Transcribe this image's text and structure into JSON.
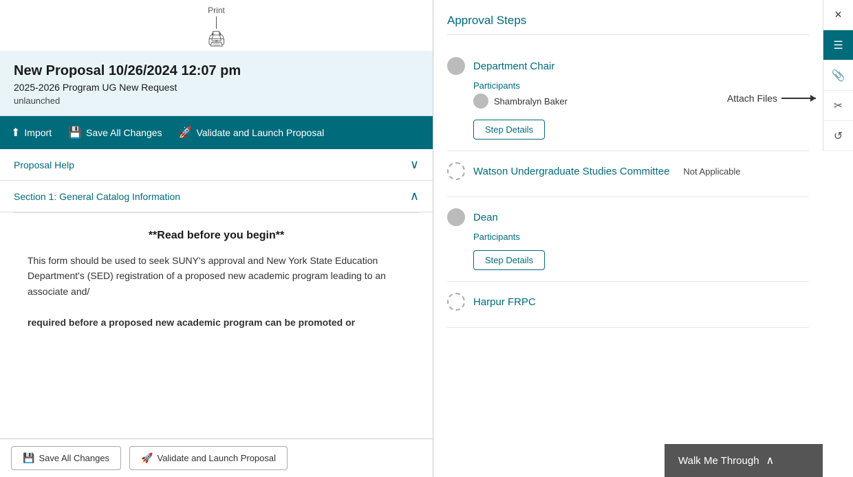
{
  "print": {
    "label": "Print"
  },
  "proposal": {
    "title": "New Proposal 10/26/2024 12:07 pm",
    "subtitle": "2025-2026 Program UG New Request",
    "status": "unlaunched"
  },
  "toolbar": {
    "import_label": "Import",
    "save_label": "Save All Changes",
    "validate_label": "Validate and Launch Proposal"
  },
  "sections": {
    "help_label": "Proposal Help",
    "section1_label": "Section 1: General Catalog Information"
  },
  "content": {
    "title": "**Read before you begin**",
    "body_part1": "This form should be used to seek SUNY's approval and New York State Education Department's (SED) registration of a proposed new academic program leading to an associate and/",
    "body_part2": "required before a proposed new academic program can be promoted or"
  },
  "bottom_bar": {
    "save_label": "Save All Changes",
    "validate_label": "Validate and Launch Proposal"
  },
  "approval": {
    "title": "Approval Steps",
    "attach_files_label": "Attach Files",
    "steps": [
      {
        "id": "dept-chair",
        "title": "Department Chair",
        "type": "filled",
        "badge": "",
        "participants_label": "Participants",
        "participants": [
          "Shambralyn Baker"
        ],
        "has_step_details": true,
        "step_details_label": "Step Details"
      },
      {
        "id": "watson",
        "title": "Watson Undergraduate Studies Committee",
        "type": "dashed",
        "badge": "Not Applicable",
        "participants_label": "",
        "participants": [],
        "has_step_details": false,
        "step_details_label": ""
      },
      {
        "id": "dean",
        "title": "Dean",
        "type": "filled",
        "badge": "",
        "participants_label": "Participants",
        "participants": [],
        "has_step_details": true,
        "step_details_label": "Step Details"
      },
      {
        "id": "harpur-frpc",
        "title": "Harpur FRPC",
        "type": "dashed",
        "badge": "",
        "participants_label": "",
        "participants": [],
        "has_step_details": false,
        "step_details_label": ""
      }
    ]
  },
  "side_icons": {
    "close": "×",
    "list": "≡",
    "attach": "📎",
    "scissors": "✂",
    "history": "↺"
  },
  "walk_me_through": {
    "label": "Walk Me Through",
    "chevron": "∧"
  }
}
